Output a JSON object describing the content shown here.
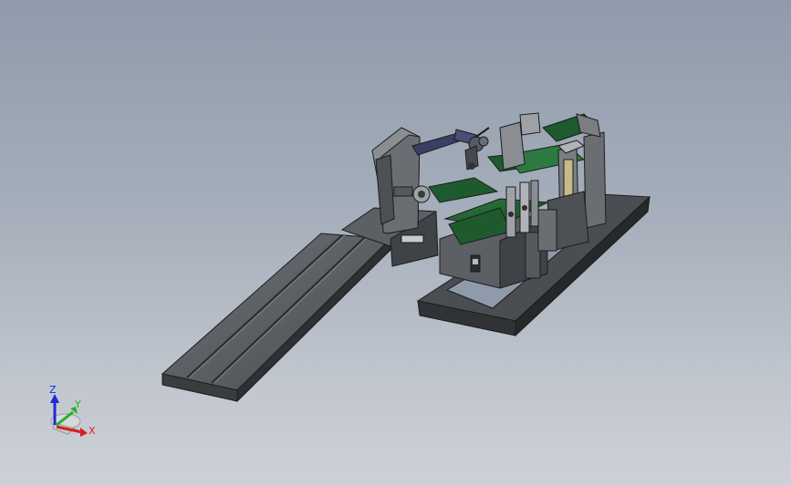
{
  "viewport": {
    "background_top": "#8f9bab",
    "background_bottom": "#cdd1d7"
  },
  "model": {
    "colors": {
      "steel_dark": "#3a3d40",
      "steel_mid": "#5c6064",
      "steel_light": "#8a8e93",
      "green_panel": "#1f5a2e",
      "green_dark": "#143d1f",
      "purple_arm": "#3b3f63",
      "edge": "#1c1d1f"
    }
  },
  "triad": {
    "z_label": "Z",
    "y_label": "Y",
    "x_label": "X",
    "z_color": "#1d2bd6",
    "y_color": "#22b022",
    "x_color": "#d81f1f",
    "base_icon": "view-orientation-triad-icon"
  }
}
